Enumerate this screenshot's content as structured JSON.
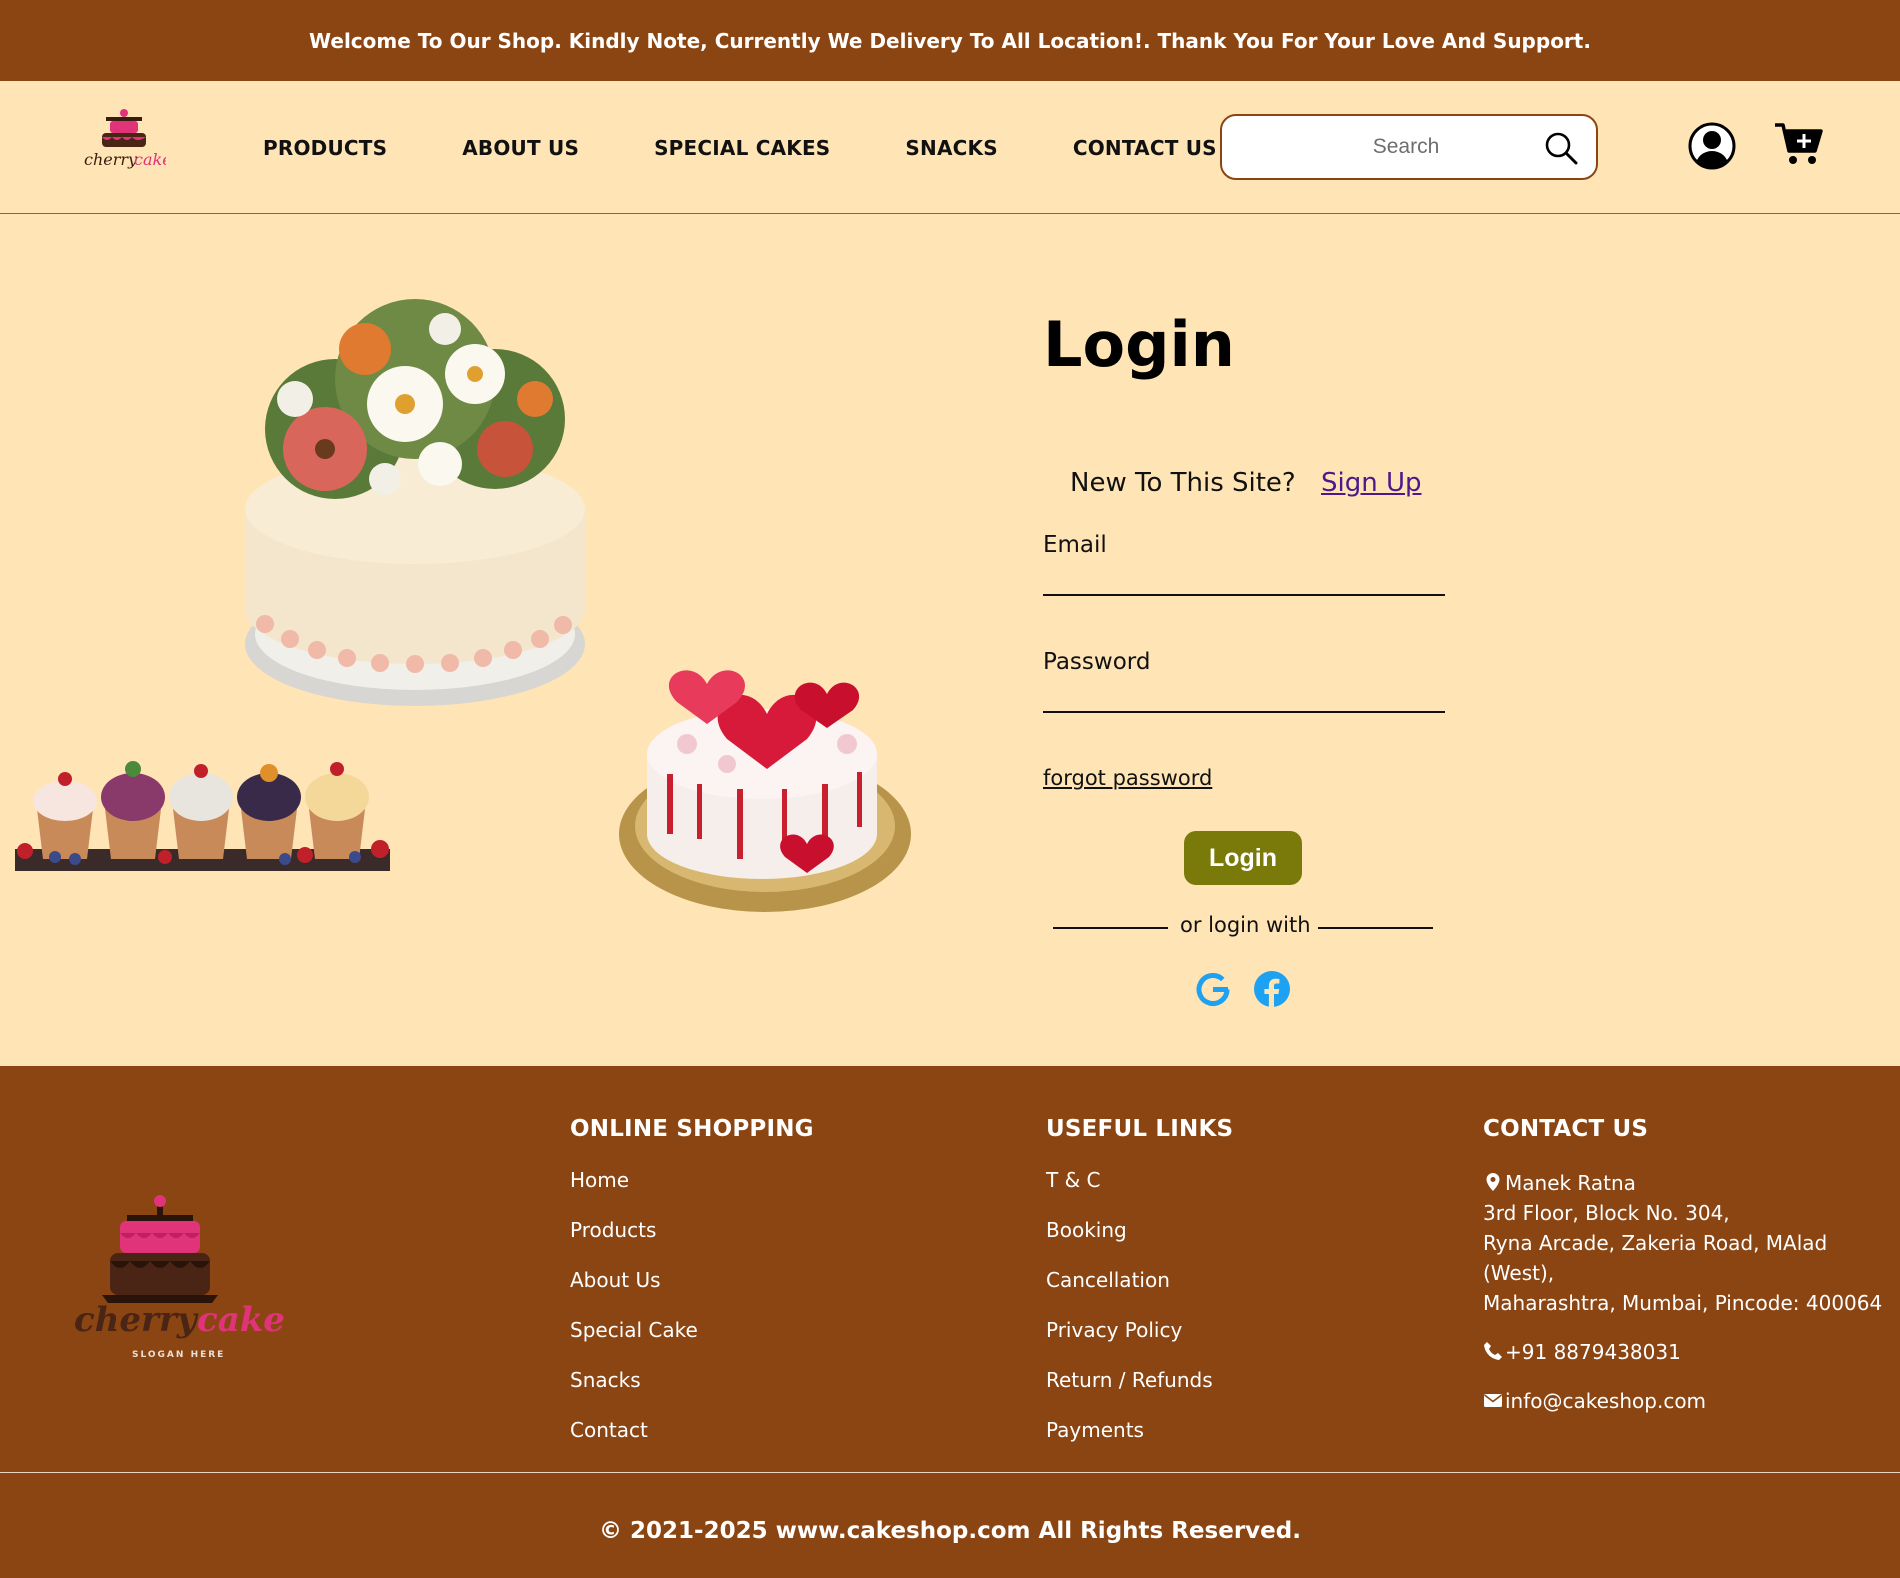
{
  "announcement": "Welcome To Our Shop. Kindly Note, Currently We Delivery To All Location!. Thank You For Your Love And Support.",
  "header": {
    "nav": [
      "PRODUCTS",
      "ABOUT US",
      "SPECIAL CAKES",
      "SNACKS",
      "CONTACT US"
    ],
    "search_placeholder": "Search",
    "logo_text": "cherry cake"
  },
  "login": {
    "title": "Login",
    "new_to_site": "New To This Site?",
    "signup": "Sign Up",
    "email_label": "Email",
    "password_label": "Password",
    "forgot": "forgot password",
    "button": "Login",
    "or_login_with": "or login with",
    "social": [
      "google-icon",
      "facebook-icon"
    ]
  },
  "footer": {
    "logo_text": "cherry cake",
    "slogan": "SLOGAN HERE",
    "online_shopping": {
      "title": "ONLINE SHOPPING",
      "links": [
        "Home",
        "Products",
        "About Us",
        "Special Cake",
        "Snacks",
        "Contact"
      ]
    },
    "useful_links": {
      "title": "USEFUL LINKS",
      "links": [
        "T & C",
        "Booking",
        "Cancellation",
        "Privacy Policy",
        "Return / Refunds",
        "Payments"
      ]
    },
    "contact": {
      "title": "CONTACT US",
      "address": [
        "Manek Ratna",
        "3rd Floor, Block No. 304,",
        "Ryna Arcade, Zakeria Road, MAlad (West),",
        "Maharashtra, Mumbai, Pincode: 400064"
      ],
      "phone": "+91 8879438031",
      "email": "info@cakeshop.com"
    },
    "copyright": "© 2021-2025 www.cakeshop.com All Rights Reserved."
  },
  "colors": {
    "brown": "#8b4513",
    "cream": "#ffe4b5",
    "olive": "#7a7a0a",
    "social": "#1da1f2"
  }
}
